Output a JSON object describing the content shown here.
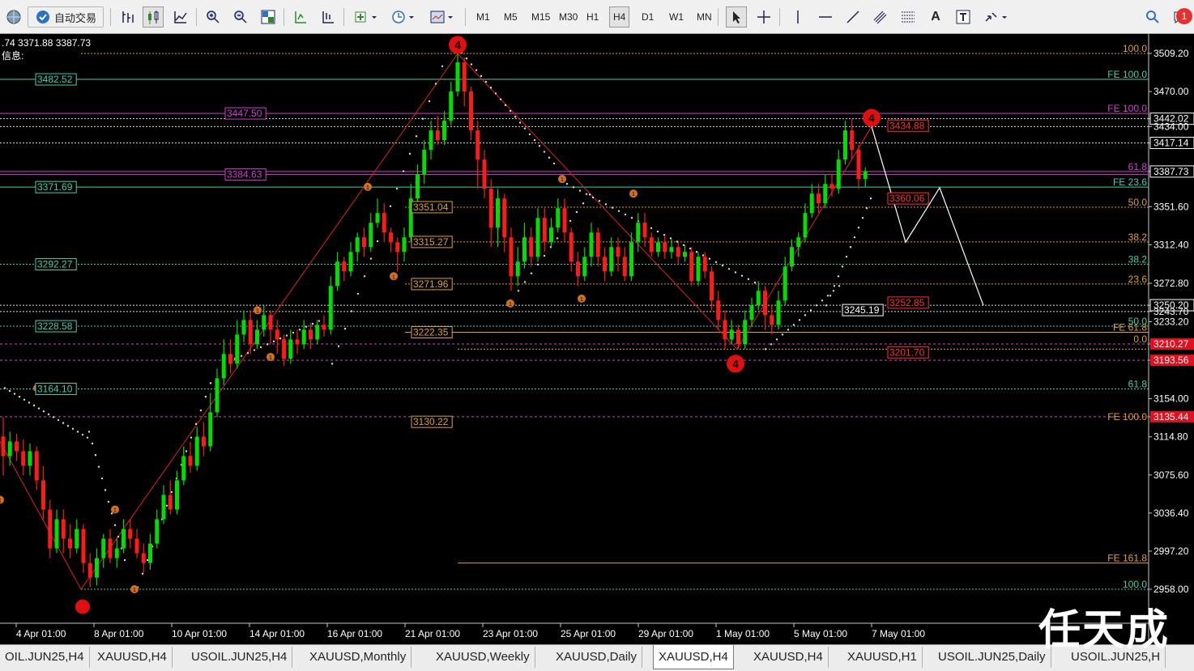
{
  "toolbar": {
    "auto_trade_label": "自动交易",
    "timeframes": [
      "M1",
      "M5",
      "M15",
      "M30",
      "H1",
      "H4",
      "D1",
      "W1",
      "MN"
    ],
    "active_timeframe": "H4",
    "text_tool": "A",
    "notification_count": "1"
  },
  "chart": {
    "ohlc_text": ".74 3371.88 3387.73",
    "info_text": "信息:",
    "bull_color": "#00dd00",
    "bear_color": "#ff1a1a",
    "price_axis": [
      {
        "p": 3509.2,
        "label": "3509.20"
      },
      {
        "p": 3470.0,
        "label": "3470.00"
      },
      {
        "p": 3442.02,
        "label": "3442.02",
        "tag": "box"
      },
      {
        "p": 3434.0,
        "label": "3434.00"
      },
      {
        "p": 3417.14,
        "label": "3417.14",
        "tag": "box"
      },
      {
        "p": 3387.73,
        "label": "3387.73",
        "tag": "box"
      },
      {
        "p": 3351.6,
        "label": "3351.60"
      },
      {
        "p": 3312.4,
        "label": "3312.40"
      },
      {
        "p": 3272.8,
        "label": "3272.80"
      },
      {
        "p": 3250.2,
        "label": "3250.20",
        "tag": "box"
      },
      {
        "p": 3243.7,
        "label": "3243.70"
      },
      {
        "p": 3233.2,
        "label": "3233.20"
      },
      {
        "p": 3210.27,
        "label": "3210.27",
        "tag": "red"
      },
      {
        "p": 3193.56,
        "label": "3193.56",
        "tag": "red"
      },
      {
        "p": 3154.0,
        "label": "3154.00"
      },
      {
        "p": 3135.44,
        "label": "3135.44",
        "tag": "red"
      },
      {
        "p": 3114.8,
        "label": "3114.80"
      },
      {
        "p": 3075.6,
        "label": "3075.60"
      },
      {
        "p": 3036.4,
        "label": "3036.40"
      },
      {
        "p": 2997.2,
        "label": "2997.20"
      },
      {
        "p": 2958.0,
        "label": "2958.00"
      }
    ],
    "time_axis": [
      "4 Apr 01:00",
      "8 Apr 01:00",
      "10 Apr 01:00",
      "14 Apr 01:00",
      "16 Apr 01:00",
      "21 Apr 01:00",
      "23 Apr 01:00",
      "25 Apr 01:00",
      "29 Apr 01:00",
      "1 May 01:00",
      "5 May 01:00",
      "7 May 01:00"
    ],
    "level_labels_left": [
      {
        "p": 3482.52,
        "text": "3482.52",
        "color": "#3fd0b0"
      },
      {
        "p": 3447.5,
        "text": "3447.50",
        "color": "#d040d0"
      },
      {
        "p": 3384.63,
        "text": "3384.63",
        "color": "#d040d0"
      },
      {
        "p": 3371.69,
        "text": "3371.69",
        "color": "#3fd0b0"
      },
      {
        "p": 3292.27,
        "text": "3292.27",
        "color": "#3fd0b0"
      },
      {
        "p": 3228.58,
        "text": "3228.58",
        "color": "#3fd0b0"
      },
      {
        "p": 3164.1,
        "text": "3164.10",
        "color": "#3fd0b0"
      }
    ],
    "level_labels_mid": [
      {
        "p": 3351.04,
        "text": "3351.04"
      },
      {
        "p": 3315.27,
        "text": "3315.27"
      },
      {
        "p": 3271.96,
        "text": "3271.96"
      },
      {
        "p": 3222.35,
        "text": "3222.35"
      },
      {
        "p": 3130.22,
        "text": "3130.22"
      }
    ],
    "level_labels_recent": [
      {
        "p": 3434.88,
        "text": "3434.88",
        "color": "#ff3030"
      },
      {
        "p": 3360.06,
        "text": "3360.06",
        "color": "#ff3030"
      },
      {
        "p": 3245.19,
        "text": "3245.19",
        "color": "#ffffff"
      },
      {
        "p": 3252.85,
        "text": "3252.85",
        "color": "#ff3030"
      },
      {
        "p": 3201.7,
        "text": "3201.70",
        "color": "#ff3030"
      }
    ],
    "fib_labels": [
      {
        "p": 3509.2,
        "text": "100.0",
        "color": "#e0a030"
      },
      {
        "p": 3482.52,
        "text": "FE 100.0",
        "color": "#3fd0b0"
      },
      {
        "p": 3447.5,
        "text": "FE 100.0",
        "color": "#d040d0"
      },
      {
        "p": 3387.73,
        "text": "61.8",
        "color": "#d040d0"
      },
      {
        "p": 3371.69,
        "text": "FE 23.6",
        "color": "#3fd0b0"
      },
      {
        "p": 3351.04,
        "text": "50.0",
        "color": "#e0a030"
      },
      {
        "p": 3315.27,
        "text": "38.2",
        "color": "#e0a030"
      },
      {
        "p": 3292.27,
        "text": "38.2",
        "color": "#3fd0b0"
      },
      {
        "p": 3271.96,
        "text": "23.6",
        "color": "#e0a030"
      },
      {
        "p": 3228.58,
        "text": "50.0",
        "color": "#3fd0b0"
      },
      {
        "p": 3222.35,
        "text": "FE 61.8",
        "color": "#e0a030"
      },
      {
        "p": 3210.27,
        "text": "0.0",
        "color": "#e0a030"
      },
      {
        "p": 3164.1,
        "text": "61.8",
        "color": "#3fd0b0"
      },
      {
        "p": 3130.22,
        "text": "FE 100.0",
        "color": "#e0a030"
      },
      {
        "p": 2985.0,
        "text": "FE 161.8",
        "color": "#e0a030"
      },
      {
        "p": 2958.0,
        "text": "100.0",
        "color": "#3fd0b0"
      }
    ],
    "wave_labels": [
      "4",
      "4",
      "4"
    ]
  },
  "tabs": [
    "OIL.JUN25,H4",
    "XAUUSD,H4",
    "USOIL.JUN25,H4",
    "XAUUSD,Monthly",
    "XAUUSD,Weekly",
    "XAUUSD,Daily",
    "XAUUSD,H4",
    "XAUUSD,H4",
    "XAUUSD,H1",
    "USOIL.JUN25,Daily",
    "USOIL.JUN25,H"
  ],
  "active_tab_index": 6,
  "watermark": "任天成"
}
